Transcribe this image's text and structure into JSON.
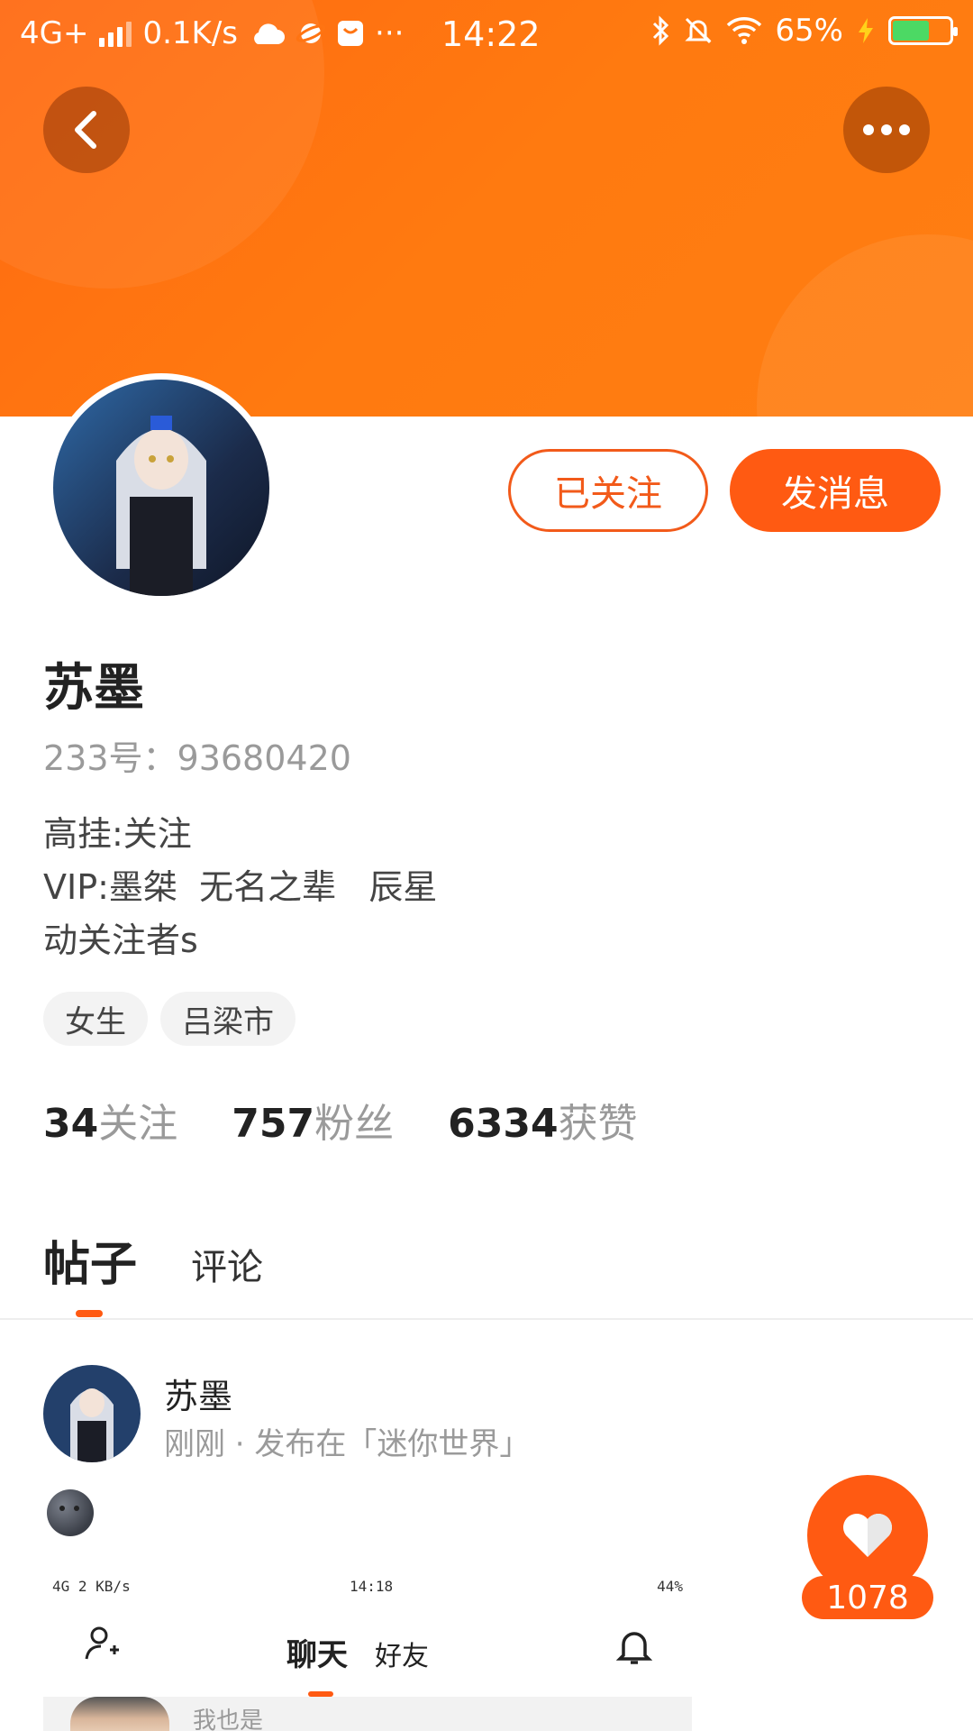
{
  "status_bar": {
    "network": "4G+",
    "speed": "0.1K/s",
    "more": "···",
    "time": "14:22",
    "battery": "65%",
    "battery_level": 0.65
  },
  "profile": {
    "name": "苏墨",
    "uid": "233号：93680420",
    "bio": "高挂:关注\nVIP:墨桀  无名之辈   辰星\n动关注者s",
    "tags": [
      "女生",
      "吕梁市"
    ],
    "follow_button": "已关注",
    "message_button": "发消息"
  },
  "stats": [
    {
      "value": "34",
      "label": "关注"
    },
    {
      "value": "757",
      "label": "粉丝"
    },
    {
      "value": "6334",
      "label": "获赞"
    }
  ],
  "tabs": {
    "posts": "帖子",
    "comments": "评论"
  },
  "post": {
    "author": "苏墨",
    "meta": "刚刚 · 发布在「迷你世界」",
    "screenshot": {
      "status_left": "4G 2 KB/s",
      "status_time": "14:18",
      "status_right": "44%",
      "tab_chat": "聊天",
      "tab_friends": "好友",
      "message_preview": "我也是"
    }
  },
  "like": {
    "count": "1078"
  },
  "colors": {
    "accent": "#ff5a12",
    "header": "#ff7412"
  }
}
